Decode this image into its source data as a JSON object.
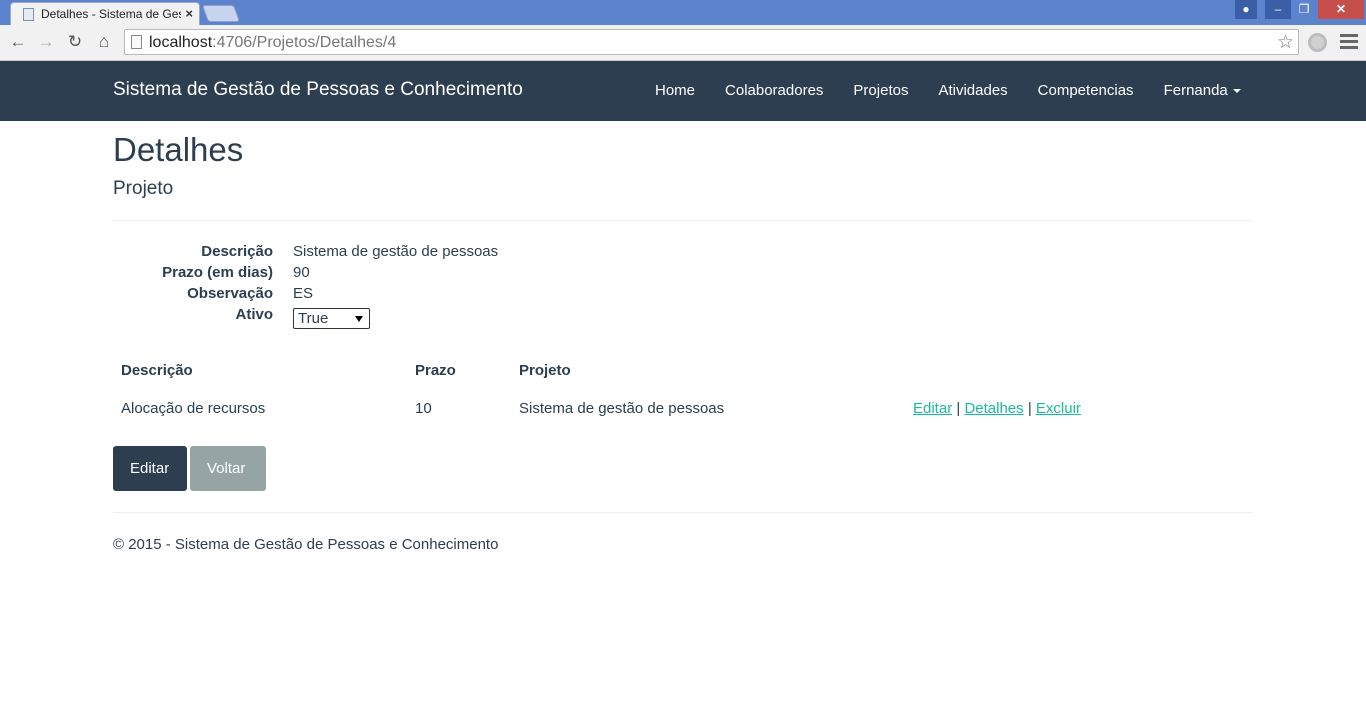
{
  "browser": {
    "tab_title": "Detalhes - Sistema de Ges",
    "tab_close": "×",
    "url_host": "localhost",
    "url_path": ":4706/Projetos/Detalhes/4",
    "window_buttons": {
      "minimize": "–",
      "maximize": "❐",
      "close": "✕"
    }
  },
  "navbar": {
    "brand": "Sistema de Gestão de Pessoas e Conhecimento",
    "links": [
      "Home",
      "Colaboradores",
      "Projetos",
      "Atividades",
      "Competencias"
    ],
    "user": "Fernanda",
    "bg_color": "#2c3e50"
  },
  "page": {
    "title": "Detalhes",
    "subtitle": "Projeto"
  },
  "details": {
    "descricao": {
      "label": "Descrição",
      "value": "Sistema de gestão de pessoas"
    },
    "prazo": {
      "label": "Prazo (em dias)",
      "value": "90"
    },
    "observacao": {
      "label": "Observação",
      "value": "ES"
    },
    "ativo": {
      "label": "Ativo",
      "value": "True"
    }
  },
  "table": {
    "headers": [
      "Descrição",
      "Prazo",
      "Projeto"
    ],
    "rows": [
      {
        "descricao": "Alocação de recursos",
        "prazo": "10",
        "projeto": "Sistema de gestão de pessoas",
        "actions": {
          "edit": "Editar",
          "details": "Detalhes",
          "delete": "Excluir",
          "separator": "|"
        }
      }
    ]
  },
  "buttons": {
    "edit": "Editar",
    "back": "Voltar"
  },
  "footer": {
    "text": "© 2015 - Sistema de Gestão de Pessoas e Conhecimento"
  },
  "colors": {
    "link": "#18bc9c",
    "primary": "#2c3e50",
    "default_button": "#95a5a6"
  }
}
